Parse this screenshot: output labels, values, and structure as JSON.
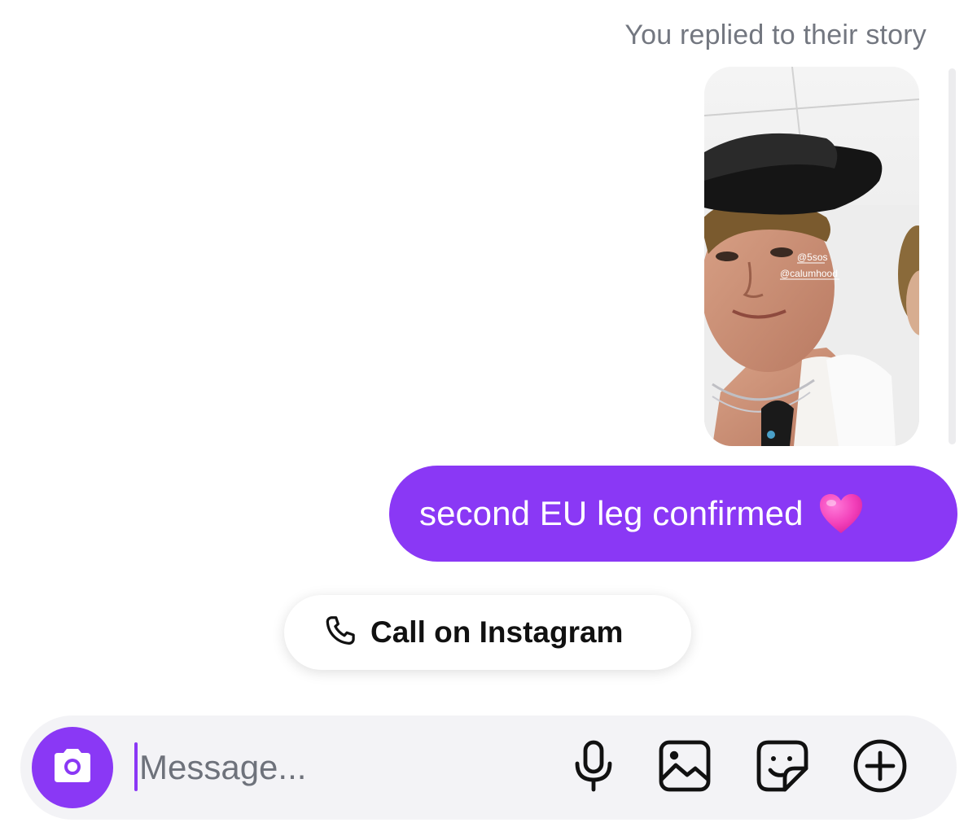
{
  "story": {
    "caption": "You replied to their story",
    "tags": [
      "@5sos",
      "@calumhood"
    ]
  },
  "message": {
    "text": "second EU leg confirmed",
    "emoji": "pink-heart"
  },
  "call_button": {
    "label": "Call on Instagram",
    "icon": "phone-icon"
  },
  "composer": {
    "placeholder": "Message...",
    "value": "",
    "icons": [
      "camera-icon",
      "microphone-icon",
      "gallery-icon",
      "sticker-icon",
      "plus-circle-icon"
    ]
  },
  "colors": {
    "accent": "#8a38f5",
    "bubble_text": "#ffffff",
    "caption_gray": "#737780",
    "composer_bg": "#f3f3f6"
  }
}
